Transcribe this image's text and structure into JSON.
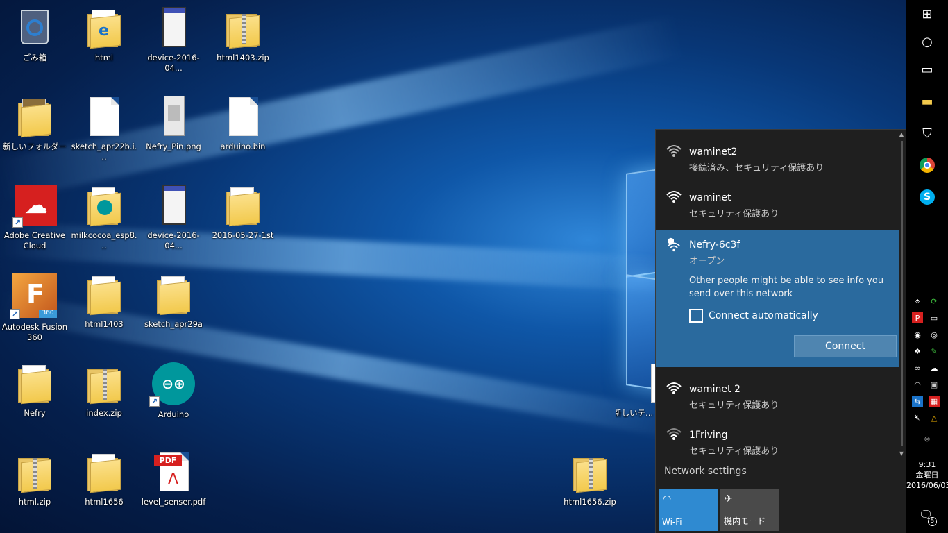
{
  "desktop": {
    "icons": [
      {
        "label": "ごみ箱",
        "kind": "recycle-bin"
      },
      {
        "label": "html",
        "kind": "folder-edge"
      },
      {
        "label": "device-2016-04...",
        "kind": "phone-screenshot"
      },
      {
        "label": "html1403.zip",
        "kind": "zip-folder"
      },
      {
        "label": "新しいフォルダー",
        "kind": "folder"
      },
      {
        "label": "sketch_apr22b.i...",
        "kind": "file"
      },
      {
        "label": "Nefry_Pin.png",
        "kind": "image"
      },
      {
        "label": "arduino.bin",
        "kind": "file"
      },
      {
        "label": "Adobe Creative Cloud",
        "kind": "adobe-cc"
      },
      {
        "label": "milkcocoa_esp8...",
        "kind": "folder-arduino"
      },
      {
        "label": "device-2016-04...",
        "kind": "phone-screenshot"
      },
      {
        "label": "2016-05-27-1st",
        "kind": "folder"
      },
      {
        "label": "Autodesk Fusion 360",
        "kind": "fusion360"
      },
      {
        "label": "html1403",
        "kind": "folder"
      },
      {
        "label": "sketch_apr29a",
        "kind": "folder"
      },
      {
        "label": "Nefry",
        "kind": "folder"
      },
      {
        "label": "index.zip",
        "kind": "zip-folder"
      },
      {
        "label": "Arduino",
        "kind": "arduino"
      },
      {
        "label": "html.zip",
        "kind": "zip-folder"
      },
      {
        "label": "html1656",
        "kind": "folder"
      },
      {
        "label": "level_senser.pdf",
        "kind": "pdf"
      },
      {
        "label": "html1656.zip",
        "kind": "zip-folder"
      },
      {
        "label": "新しいテ... メン",
        "kind": "file-partial"
      }
    ]
  },
  "wifi": {
    "networks": [
      {
        "name": "waminet2",
        "status": "接続済み、セキュリティ保護あり"
      },
      {
        "name": "waminet",
        "status": "セキュリティ保護あり"
      },
      {
        "name": "Nefry-6c3f",
        "status": "オープン"
      },
      {
        "name": "waminet 2",
        "status": "セキュリティ保護あり"
      },
      {
        "name": "1Friving",
        "status": "セキュリティ保護あり"
      }
    ],
    "selected_warning": "Other people might be able to see info you send over this network",
    "connect_auto_label": "Connect automatically",
    "connect_label": "Connect",
    "network_settings": "Network settings",
    "tiles": {
      "wifi": "Wi-Fi",
      "airplane": "機内モード"
    }
  },
  "taskbar": {
    "clock_time": "9:31",
    "clock_day": "金曜日",
    "clock_date": "2016/06/03",
    "notification_count": "5"
  },
  "colors": {
    "accent": "#2f8ad1",
    "selected": "#2a6a9e",
    "flyout_bg": "#1f1f1f"
  }
}
